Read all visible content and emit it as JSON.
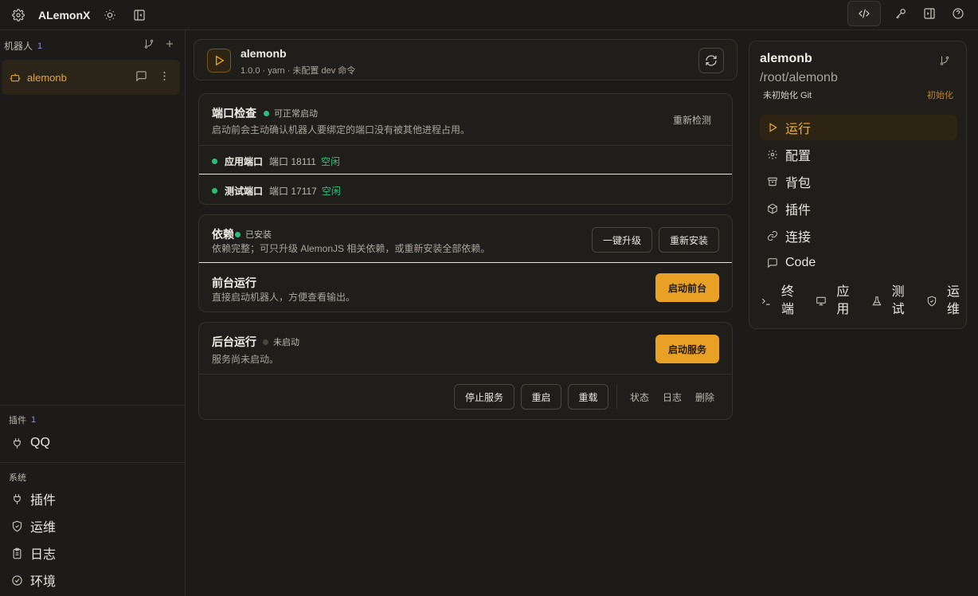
{
  "topbar": {
    "app_title": "ALemonX"
  },
  "sidebar": {
    "bots_label": "机器人",
    "bots_count": "1",
    "bot": {
      "name": "alemonb"
    },
    "plugins_label": "插件",
    "plugins_count": "1",
    "plugin_items": [
      {
        "label": "QQ",
        "icon": "plug-icon"
      }
    ],
    "system_label": "系统",
    "system_items": [
      {
        "label": "插件",
        "icon": "plug-icon"
      },
      {
        "label": "运维",
        "icon": "shield-icon"
      },
      {
        "label": "日志",
        "icon": "clipboard-icon"
      },
      {
        "label": "环境",
        "icon": "check-circle-icon"
      }
    ]
  },
  "header": {
    "title": "alemonb",
    "subtitle": "1.0.0 · yarn · 未配置 dev 命令"
  },
  "port_check": {
    "title": "端口检查",
    "status": "可正常启动",
    "description": "启动前会主动确认机器人要绑定的端口没有被其他进程占用。",
    "recheck_label": "重新检测",
    "ports": [
      {
        "label": "应用端口",
        "value": "端口 18111",
        "state": "空闲"
      },
      {
        "label": "测试端口",
        "value": "端口 17117",
        "state": "空闲"
      }
    ]
  },
  "deps": {
    "title": "依赖",
    "status": "已安装",
    "description": "依赖完整；可只升级 AlemonJS 相关依赖，或重新安装全部依赖。",
    "upgrade_label": "一键升级",
    "reinstall_label": "重新安装"
  },
  "foreground": {
    "title": "前台运行",
    "description": "直接启动机器人，方便查看输出。",
    "start_label": "启动前台"
  },
  "background": {
    "title": "后台运行",
    "status": "未启动",
    "description": "服务尚未启动。",
    "start_label": "启动服务",
    "stop_label": "停止服务",
    "restart_label": "重启",
    "reload_label": "重载",
    "status_label": "状态",
    "logs_label": "日志",
    "delete_label": "删除"
  },
  "right_panel": {
    "title": "alemonb",
    "path": "/root/alemonb",
    "git_status": "未初始化 Git",
    "init_label": "初始化",
    "nav": [
      {
        "label": "运行",
        "icon": "play-icon",
        "active": true
      },
      {
        "label": "配置",
        "icon": "gear-icon"
      },
      {
        "label": "背包",
        "icon": "archive-icon"
      },
      {
        "label": "插件",
        "icon": "package-icon"
      },
      {
        "label": "连接",
        "icon": "link-icon"
      },
      {
        "label": "Code",
        "icon": "message-icon"
      }
    ],
    "tools": [
      {
        "label": "终端",
        "icon": "terminal-icon"
      },
      {
        "label": "应用",
        "icon": "monitor-icon"
      },
      {
        "label": "测试",
        "icon": "flask-icon"
      },
      {
        "label": "运维",
        "icon": "shield-icon"
      }
    ]
  },
  "colors": {
    "accent": "#e8a025",
    "success": "#2bbd7e",
    "background": "#1c1b19"
  }
}
